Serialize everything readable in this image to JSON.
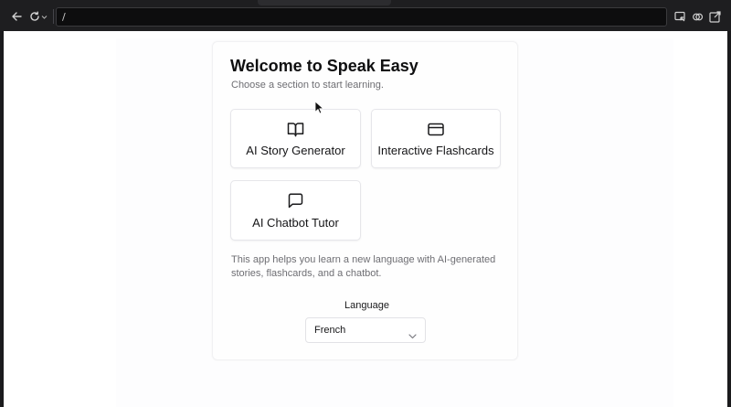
{
  "browser": {
    "url": "/",
    "icons": [
      "back-arrow-icon",
      "reload-icon",
      "chevron-down-icon",
      "inspect-icon",
      "link-icon",
      "external-link-icon"
    ]
  },
  "page": {
    "title": "Welcome to Speak Easy",
    "subtitle": "Choose a section to start learning.",
    "sections": [
      {
        "label": "AI Story Generator",
        "icon": "book-open-icon"
      },
      {
        "label": "Interactive Flashcards",
        "icon": "credit-card-icon"
      },
      {
        "label": "AI Chatbot Tutor",
        "icon": "message-square-icon"
      }
    ],
    "description": "This app helps you learn a new language with AI-generated stories, flashcards, and a chatbot.",
    "language": {
      "label": "Language",
      "selected": "French",
      "icon": "chevron-down-icon"
    }
  },
  "colors": {
    "chrome_bg": "#1e1e20",
    "page_bg": "#ffffff",
    "text_primary": "#0f0f10",
    "text_muted": "#6e6e73",
    "border": "#e6e6ea"
  }
}
